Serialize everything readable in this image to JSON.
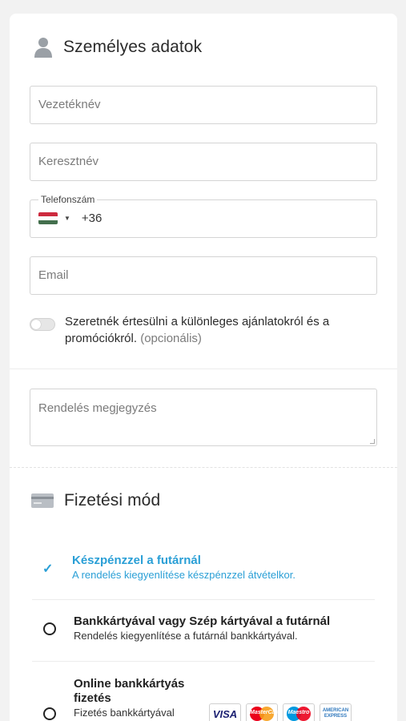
{
  "personal": {
    "title": "Személyes adatok",
    "icon": "user-icon",
    "last_name_placeholder": "Vezetéknév",
    "first_name_placeholder": "Keresztnév",
    "phone_label": "Telefonszám",
    "phone_country": "Hungary",
    "phone_prefix": "+36",
    "email_placeholder": "Email",
    "opt_in_text": "Szeretnék értesülni a különleges ajánlatokról és a promóciókról.",
    "opt_in_optional": "(opcionális)",
    "opt_in_enabled": false
  },
  "order_note": {
    "placeholder": "Rendelés megjegyzés"
  },
  "payment": {
    "title": "Fizetési mód",
    "icon": "credit-card-icon",
    "options": [
      {
        "title": "Készpénzzel a futárnál",
        "description": "A rendelés kiegyenlítése készpénzzel átvételkor.",
        "selected": true
      },
      {
        "title": "Bankkártyával vagy Szép kártyával a futárnál",
        "description": "Rendelés kiegyenlítése a futárnál bankkártyával.",
        "selected": false
      },
      {
        "title": "Online bankkártyás fizetés",
        "description": "Fizetés bankkártyával",
        "selected": false
      }
    ],
    "card_logos": {
      "visa": "VISA",
      "mastercard": "MasterCard",
      "maestro": "Maestro",
      "amex": "AMERICAN EXPRESS"
    }
  },
  "colors": {
    "accent": "#2a9fd6",
    "text": "#222222",
    "border": "#d4d4d4",
    "muted": "#7b7b7b"
  }
}
